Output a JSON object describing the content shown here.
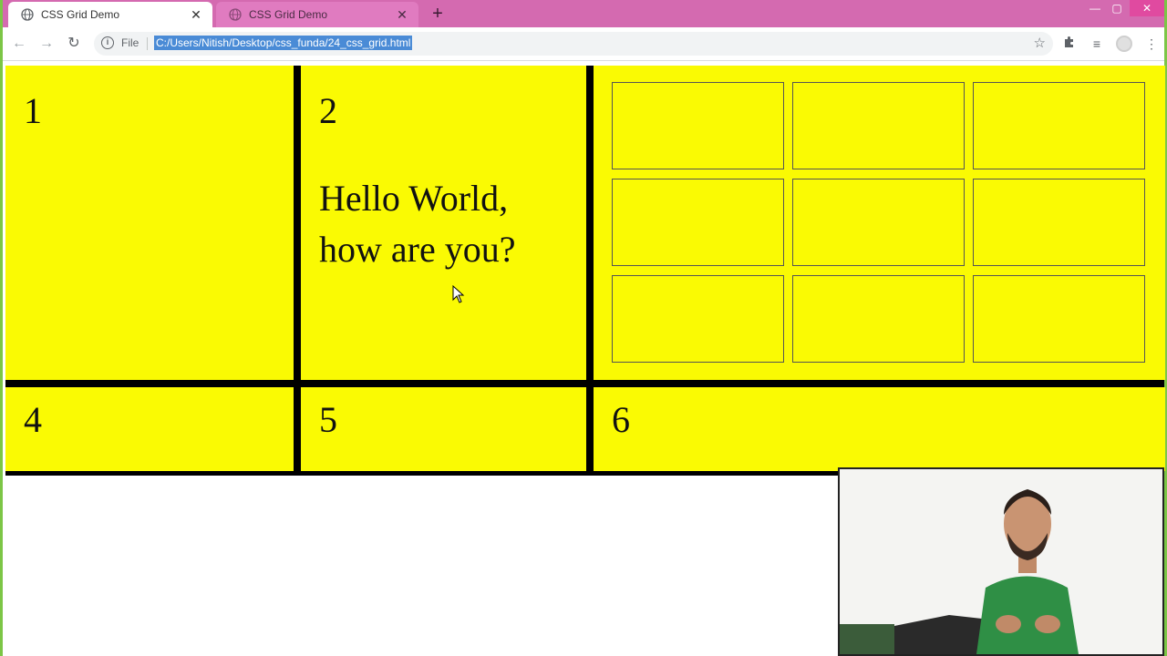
{
  "browser": {
    "tabs": [
      {
        "title": "CSS Grid Demo",
        "active": true
      },
      {
        "title": "CSS Grid Demo",
        "active": false
      }
    ],
    "omnibox": {
      "scheme_label": "File",
      "url": "C:/Users/Nitish/Desktop/css_funda/24_css_grid.html"
    },
    "colors": {
      "tabstrip": "#d46ab0",
      "window_border": "#7cc646"
    }
  },
  "page": {
    "grid_items": [
      {
        "label": "1"
      },
      {
        "label": "2",
        "text": "Hello World, how are you?"
      },
      {
        "label": ""
      },
      {
        "label": "4"
      },
      {
        "label": "5"
      },
      {
        "label": "6"
      }
    ],
    "nested_grid_cells": 9,
    "colors": {
      "cell_background": "#fafa03",
      "grid_gap": "#000000"
    }
  },
  "webcam": {
    "description_icon": "presenter-video"
  }
}
